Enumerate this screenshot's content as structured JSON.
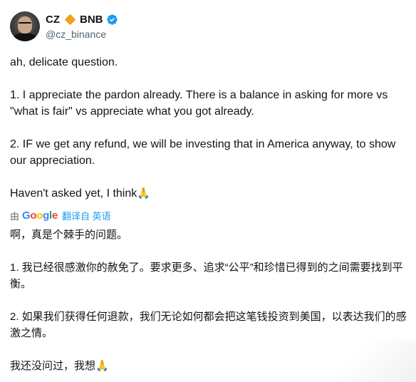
{
  "author": {
    "name": "CZ",
    "label": "BNB",
    "handle": "@cz_binance"
  },
  "tweet": {
    "paragraphs": [
      "ah, delicate question.",
      "1. I appreciate the pardon already. There is a balance in asking for more vs \"what is fair\" vs appreciate what you got already.",
      "2. IF we get any refund, we will be investing that in America anyway, to show our appreciation.",
      "Haven't asked yet, I think"
    ],
    "emoji": "🙏"
  },
  "translation_bar": {
    "prefix": "由",
    "google": [
      "G",
      "o",
      "o",
      "g",
      "l",
      "e"
    ],
    "link": "翻译自 英语"
  },
  "translation": {
    "paragraphs": [
      "啊，真是个棘手的问题。",
      "1. 我已经很感激你的赦免了。要求更多、追求“公平”和珍惜已得到的之间需要找到平衡。",
      "2. 如果我们获得任何退款，我们无论如何都会把这笔钱投资到美国，以表达我们的感激之情。",
      "我还没问过，我想"
    ],
    "emoji": "🙏"
  },
  "colors": {
    "brand_diamond": "#f0a11f",
    "verified": "#1d9bf0",
    "link": "#1d9bf0",
    "secondary_text": "#536471"
  },
  "icons": [
    "avatar",
    "diamond-icon",
    "verified-badge-icon",
    "pray-emoji",
    "google-logo"
  ]
}
